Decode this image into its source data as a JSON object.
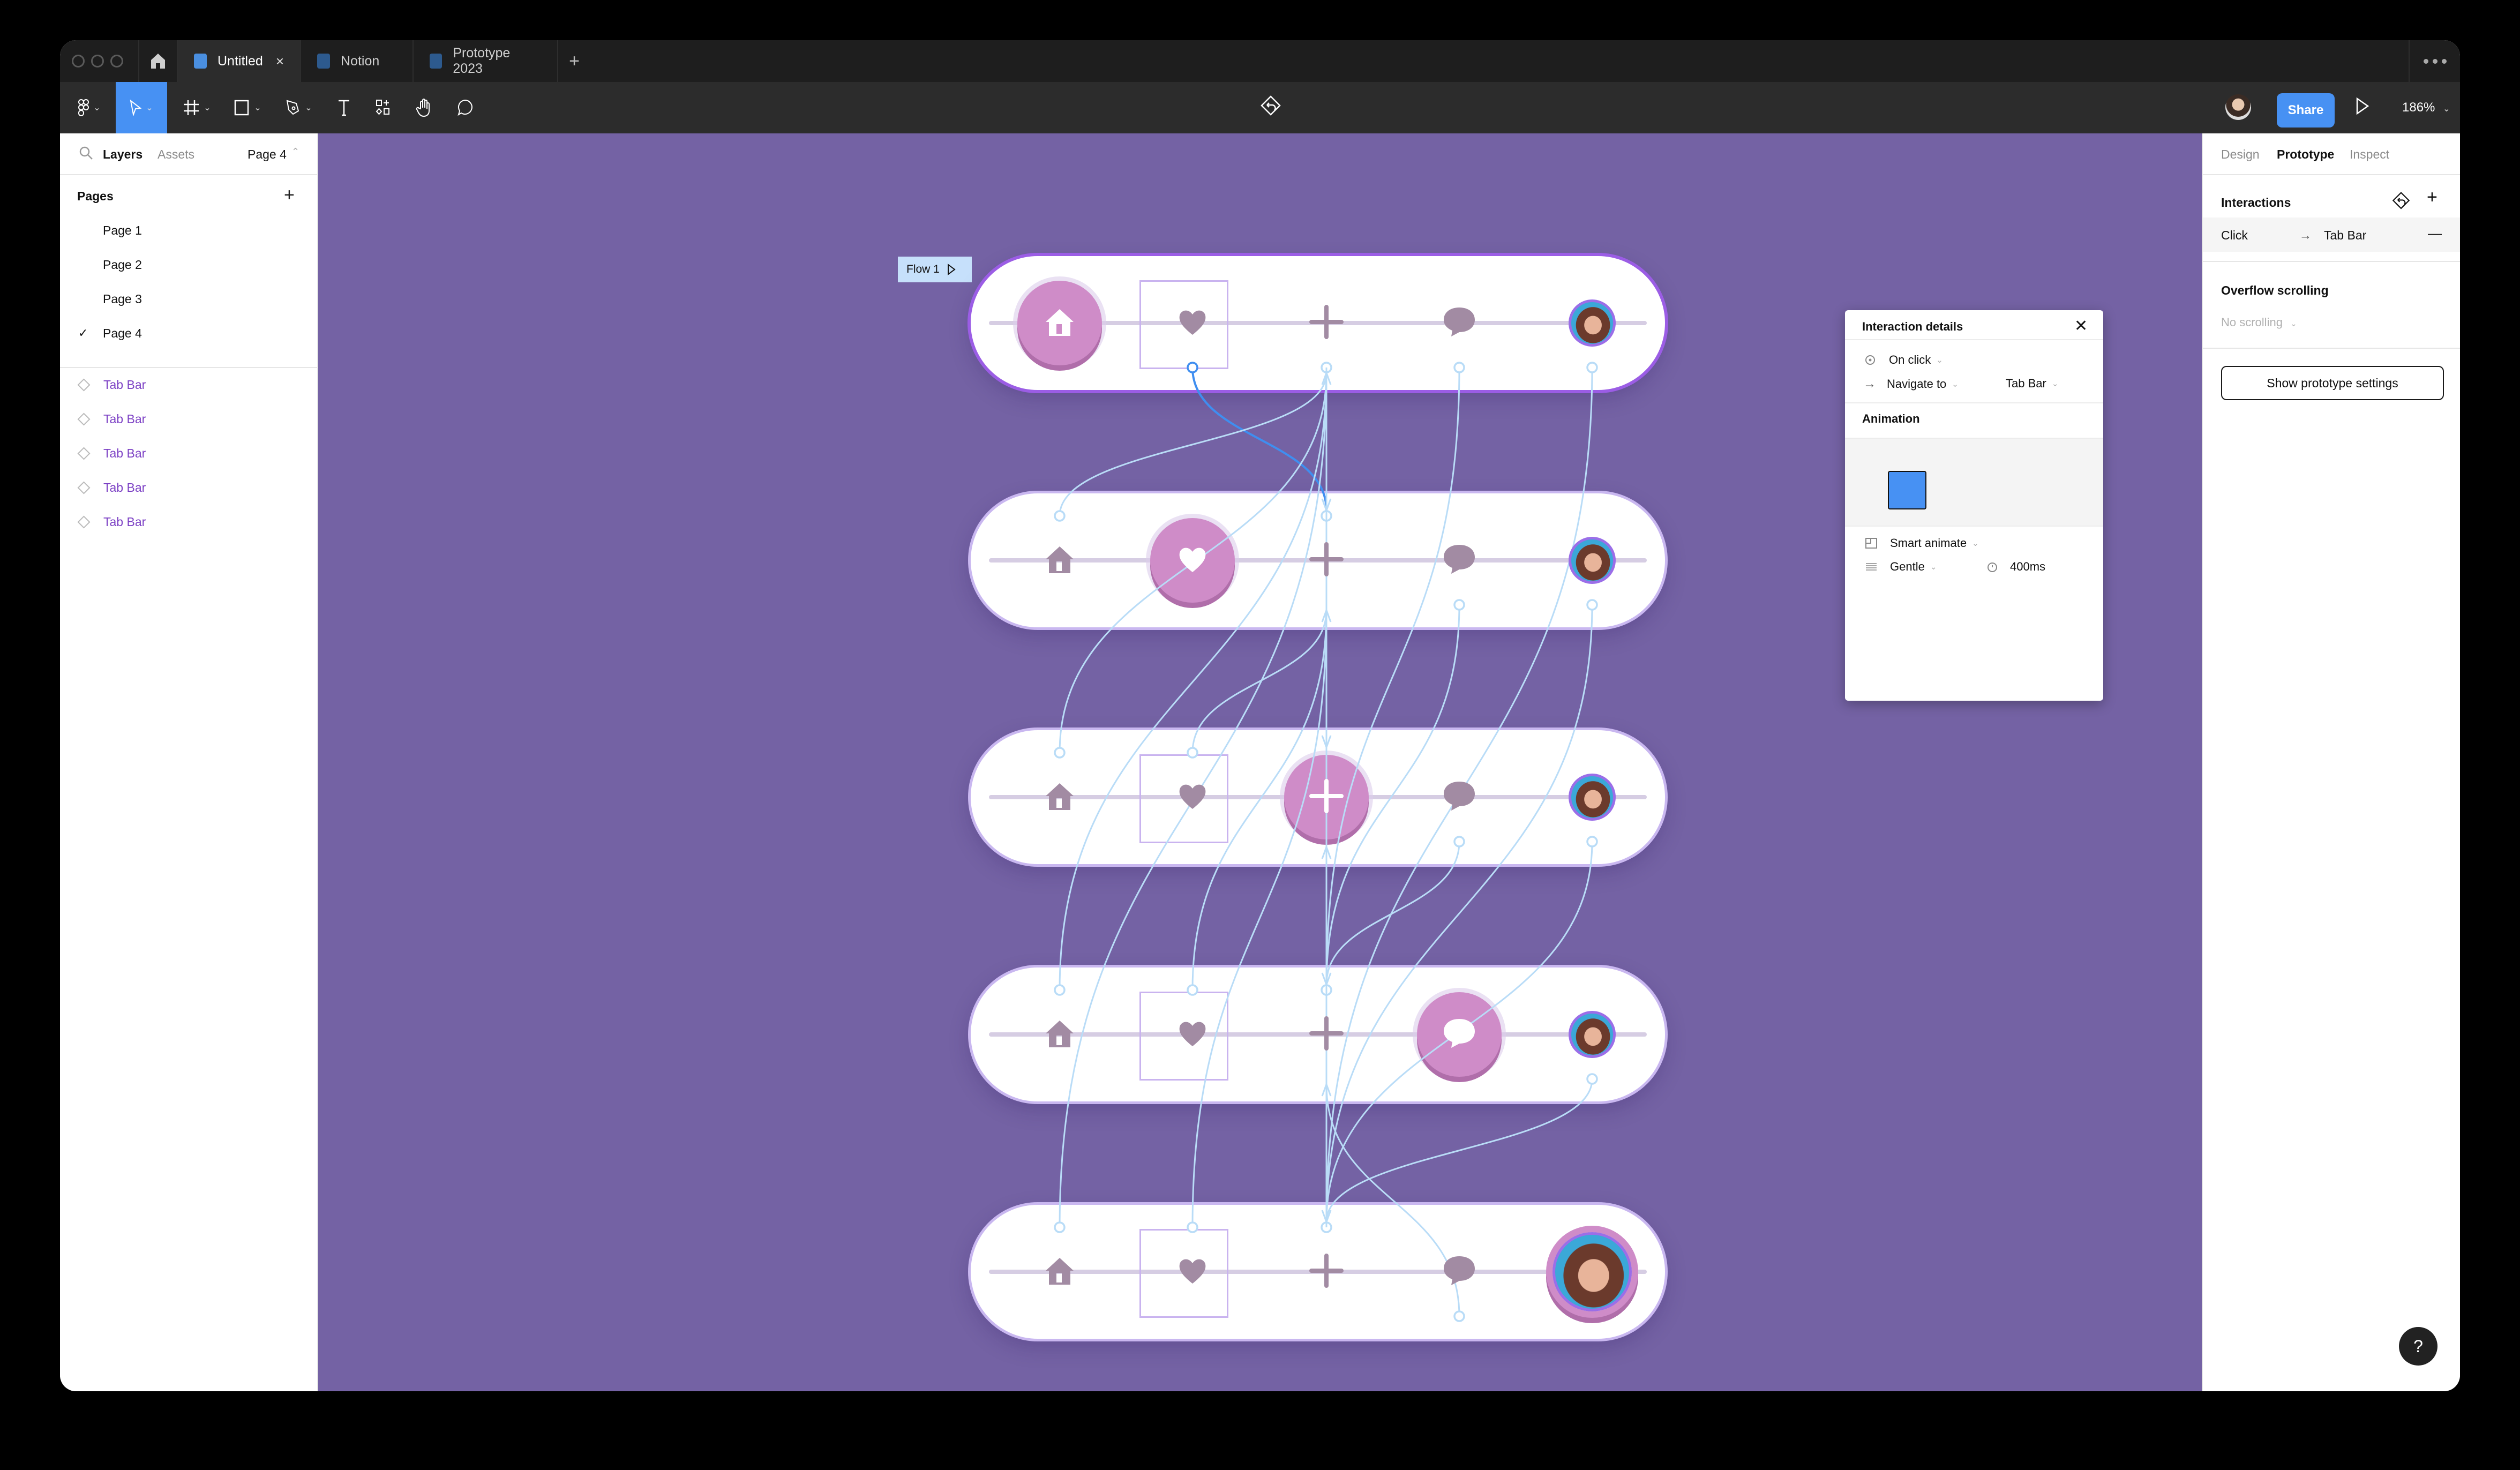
{
  "window": {
    "tabs": [
      {
        "label": "Untitled",
        "active": true,
        "close": "×"
      },
      {
        "label": "Notion",
        "active": false
      },
      {
        "label": "Prototype 2023",
        "active": false
      }
    ],
    "new_tab": "+",
    "more": "more-options"
  },
  "toolbar": {
    "tools": [
      "main-menu",
      "move",
      "frame",
      "shape",
      "pen",
      "text",
      "components",
      "hand",
      "comment"
    ],
    "active_tool": "move",
    "share_label": "Share",
    "zoom": "186%",
    "center_icon": "prototype-back"
  },
  "left_panel": {
    "tabs": {
      "layers": "Layers",
      "assets": "Assets"
    },
    "current_page": "Page 4",
    "pages_title": "Pages",
    "pages": [
      "Page 1",
      "Page 2",
      "Page 3",
      "Page 4"
    ],
    "selected_page_index": 3,
    "check": "✓",
    "layers": [
      "Tab Bar",
      "Tab Bar",
      "Tab Bar",
      "Tab Bar",
      "Tab Bar"
    ]
  },
  "canvas": {
    "background": "#7462a4",
    "flow_label": "Flow 1",
    "tab_bars": [
      {
        "active_item": "home",
        "items": [
          "home",
          "heart",
          "plus",
          "chat",
          "profile"
        ]
      },
      {
        "active_item": "heart",
        "items": [
          "home",
          "heart",
          "plus",
          "chat",
          "profile"
        ]
      },
      {
        "active_item": "plus",
        "items": [
          "home",
          "heart",
          "plus",
          "chat",
          "profile"
        ]
      },
      {
        "active_item": "chat",
        "items": [
          "home",
          "heart",
          "plus",
          "chat",
          "profile"
        ]
      },
      {
        "active_item": "profile",
        "items": [
          "home",
          "heart",
          "plus",
          "chat",
          "profile"
        ]
      }
    ],
    "accent_color": "#cf8cc8",
    "connector_color": "#b9dcf7",
    "selected_connector_color": "#3f8ef0"
  },
  "interaction_popup": {
    "title": "Interaction details",
    "trigger": "On click",
    "action": "Navigate to",
    "destination": "Tab Bar",
    "animation_title": "Animation",
    "animation_type": "Smart animate",
    "easing": "Gentle",
    "duration": "400ms"
  },
  "right_panel": {
    "tabs": {
      "design": "Design",
      "prototype": "Prototype",
      "inspect": "Inspect"
    },
    "interactions_title": "Interactions",
    "interaction": {
      "trigger": "Click",
      "destination": "Tab Bar"
    },
    "overflow_title": "Overflow scrolling",
    "overflow_value": "No scrolling",
    "settings_button": "Show prototype settings",
    "help": "?"
  }
}
